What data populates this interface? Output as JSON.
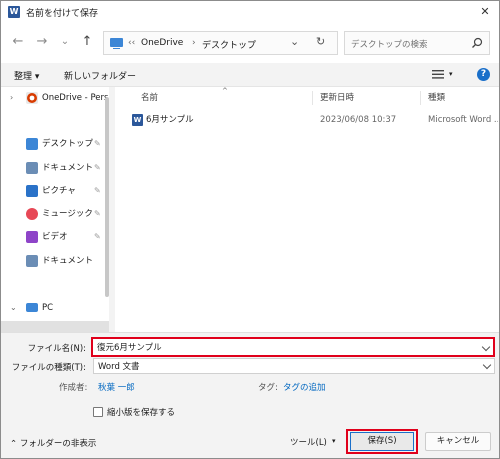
{
  "window": {
    "title": "名前を付けて保存",
    "close_glyph": "✕",
    "app_icon_letter": "W"
  },
  "nav": {
    "back_glyph": "←",
    "forward_glyph": "→",
    "recent_glyph": "⌄",
    "up_glyph": "↑",
    "breadcrumb_sep": "‹‹",
    "crumbs": [
      "OneDrive",
      "デスクトップ"
    ],
    "chevron_glyph": "⌄",
    "refresh_glyph": "↻",
    "search_placeholder": "デスクトップの検索"
  },
  "command_bar": {
    "organize": "整理 ▾",
    "new_folder": "新しいフォルダー",
    "view_caret": "▾",
    "help": "?"
  },
  "sidebar": {
    "items": [
      {
        "label": "OneDrive - Pers",
        "icon": "onedrive-icon",
        "color": "#d83b01",
        "expand": "›"
      },
      {
        "label": "デスクトップ",
        "icon": "desktop-folder-icon",
        "color": "#3c86d6",
        "pin": "📌"
      },
      {
        "label": "ドキュメント",
        "icon": "documents-folder-icon",
        "color": "#6b8db5",
        "pin": "📌"
      },
      {
        "label": "ピクチャ",
        "icon": "pictures-folder-icon",
        "color": "#2a72c8",
        "pin": "📌"
      },
      {
        "label": "ミュージック",
        "icon": "music-folder-icon",
        "color": "#e74856",
        "pin": "📌"
      },
      {
        "label": "ビデオ",
        "icon": "videos-folder-icon",
        "color": "#8e44c8",
        "pin": "📌"
      },
      {
        "label": "ドキュメント",
        "icon": "documents-folder-icon",
        "color": "#6b8db5"
      },
      {
        "label": "PC",
        "icon": "pc-icon",
        "color": "#3c86d6",
        "expand": "⌄"
      }
    ]
  },
  "files": {
    "columns": {
      "name": "名前",
      "date": "更新日時",
      "type": "種類"
    },
    "sort_caret": "^",
    "rows": [
      {
        "name": "6月サンプル",
        "date": "2023/06/08 10:37",
        "type": "Microsoft Word ..."
      }
    ]
  },
  "form": {
    "filename_label": "ファイル名(N):",
    "filename_value": "復元6月サンプル",
    "filetype_label": "ファイルの種類(T):",
    "filetype_value": "Word 文書",
    "author_label": "作成者:",
    "author_value": "秋葉 一郎",
    "tags_label": "タグ:",
    "tags_value": "タグの追加",
    "thumbnail_label": "縮小版を保存する"
  },
  "footer": {
    "hide_folders": "フォルダーの非表示",
    "hide_caret": "⌃",
    "tools": "ツール(L)",
    "tools_caret": "▾",
    "save": "保存(S)",
    "cancel": "キャンセル"
  }
}
